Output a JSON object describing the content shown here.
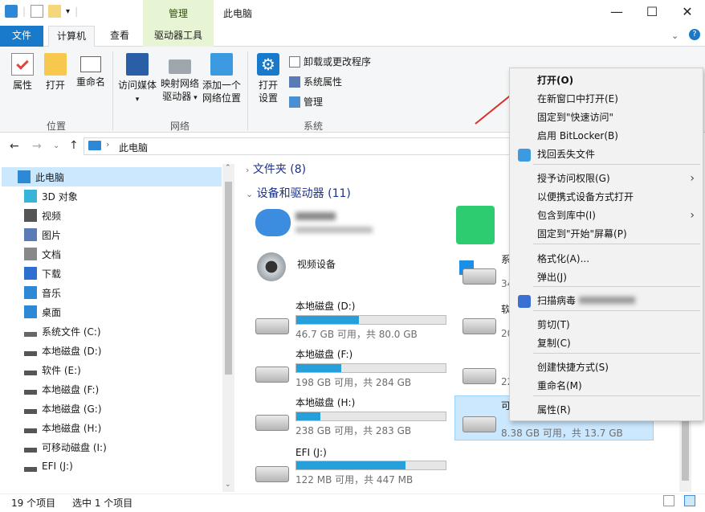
{
  "window": {
    "title": "此电脑",
    "manage_tab": "管理"
  },
  "tabs": {
    "file": "文件",
    "computer": "计算机",
    "view": "查看",
    "drive_tools": "驱动器工具"
  },
  "ribbon": {
    "properties": "属性",
    "open": "打开",
    "rename": "重命名",
    "access_media": "访问媒体",
    "map_drive_1": "映射网络",
    "map_drive_2": "驱动器",
    "add_location_1": "添加一个",
    "add_location_2": "网络位置",
    "open_settings_1": "打开",
    "open_settings_2": "设置",
    "uninstall": "卸载或更改程序",
    "system_props": "系统属性",
    "manage": "管理",
    "group_location": "位置",
    "group_network": "网络",
    "group_system": "系统"
  },
  "address": {
    "path": "此电脑"
  },
  "nav": {
    "items": [
      {
        "label": "此电脑"
      },
      {
        "label": "3D 对象"
      },
      {
        "label": "视频"
      },
      {
        "label": "图片"
      },
      {
        "label": "文档"
      },
      {
        "label": "下载"
      },
      {
        "label": "音乐"
      },
      {
        "label": "桌面"
      },
      {
        "label": "系统文件 (C:)"
      },
      {
        "label": "本地磁盘 (D:)"
      },
      {
        "label": "软件 (E:)"
      },
      {
        "label": "本地磁盘 (F:)"
      },
      {
        "label": "本地磁盘 (G:)"
      },
      {
        "label": "本地磁盘 (H:)"
      },
      {
        "label": "可移动磁盘 (I:)"
      },
      {
        "label": "EFI (J:)"
      }
    ]
  },
  "content": {
    "folders_header": "文件夹 (8)",
    "devices_header": "设备和驱动器 (11)",
    "video_device": "视频设备",
    "drives": [
      {
        "label": "本地磁盘 (D:)",
        "sub": "46.7 GB 可用，共 80.0 GB",
        "used": 0.42
      },
      {
        "label": "本地磁盘 (F:)",
        "sub": "198 GB 可用，共 284 GB",
        "used": 0.3
      },
      {
        "label": "本地磁盘 (H:)",
        "sub": "238 GB 可用，共 283 GB",
        "used": 0.16
      },
      {
        "label": "EFI (J:)",
        "sub": "122 MB 可用，共 447 MB",
        "used": 0.73
      }
    ],
    "right_partial": {
      "c": "系",
      "c_sub": "34",
      "e": "软",
      "e_sub": "20",
      "g_sub": "22",
      "i": "可",
      "i_sub": "8.38 GB 可用，共 13.7 GB"
    }
  },
  "context_menu": {
    "items": [
      "打开(O)",
      "在新窗口中打开(E)",
      "固定到\"快速访问\"",
      "启用 BitLocker(B)",
      "找回丢失文件",
      "授予访问权限(G)",
      "以便携式设备方式打开",
      "包含到库中(I)",
      "固定到\"开始\"屏幕(P)",
      "格式化(A)...",
      "弹出(J)",
      "扫描病毒",
      "剪切(T)",
      "复制(C)",
      "创建快捷方式(S)",
      "重命名(M)",
      "属性(R)"
    ]
  },
  "status": {
    "count": "19 个项目",
    "selected": "选中 1 个项目"
  }
}
